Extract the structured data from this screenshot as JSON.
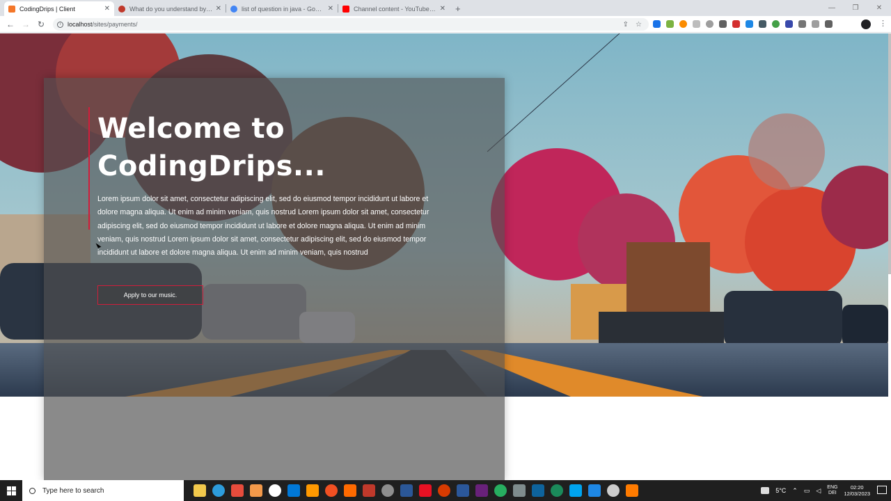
{
  "browser": {
    "tabs": [
      {
        "title": "CodingDrips | Client",
        "favicon_color": "#f4772a",
        "active": true
      },
      {
        "title": "What do you understand by 'di...",
        "favicon_color": "#c0392b",
        "active": false
      },
      {
        "title": "list of question in java - Google...",
        "favicon_color": "#4285f4",
        "active": false
      },
      {
        "title": "Channel content - YouTube Studi...",
        "favicon_color": "#ff0000",
        "active": false
      }
    ],
    "new_tab": "+",
    "url_host": "localhost",
    "url_path": "/sites/payments/"
  },
  "hero": {
    "title_line1": "Welcome to",
    "title_line2": "CodingDrips...",
    "body": "Lorem ipsum dolor sit amet, consectetur adipiscing elit, sed do eiusmod tempor incididunt ut labore et dolore magna aliqua. Ut enim ad minim veniam, quis nostrud Lorem ipsum dolor sit amet, consectetur adipiscing elit, sed do eiusmod tempor incididunt ut labore et dolore magna aliqua. Ut enim ad minim veniam, quis nostrud Lorem ipsum dolor sit amet, consectetur adipiscing elit, sed do eiusmod tempor incididunt ut labore et dolore magna aliqua. Ut enim ad minim veniam, quis nostrud",
    "cta_label": "Apply to our music.",
    "accent_color": "#d11d3b"
  },
  "taskbar": {
    "search_placeholder": "Type here to search",
    "app_icon_colors": [
      "#f2c94c",
      "#2d9cdb",
      "#e74c3c",
      "#f2994a",
      "#ffffff",
      "#0078d7",
      "#ff9900",
      "#f25022",
      "#ff6a00",
      "#c0392b",
      "#8e8e8e",
      "#2b5797",
      "#e81123",
      "#d83b01",
      "#2b579a",
      "#68217a",
      "#27ae60",
      "#7f8c8d",
      "#0e639c",
      "#1b8a5a",
      "#00a4ef",
      "#1e88e5",
      "#cccccc",
      "#ff7b00"
    ],
    "weather": "5°C",
    "lang_line1": "ENG",
    "lang_line2": "DEI",
    "time": "02:20",
    "date": "12/03/2023"
  }
}
